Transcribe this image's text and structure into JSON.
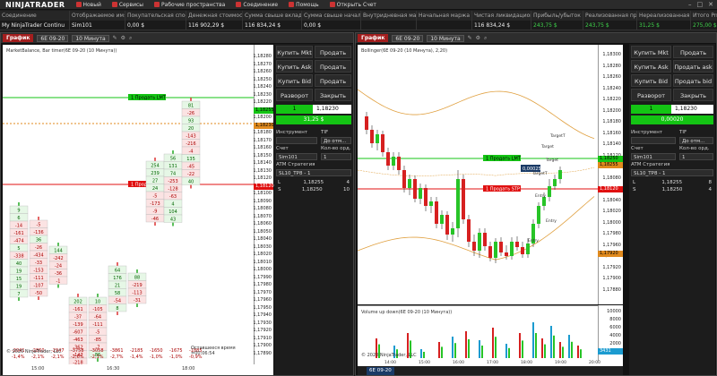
{
  "menu": {
    "logo": "NINJATRADER",
    "items": [
      "Новый",
      "Сервисы",
      "Рабочие пространства",
      "Соединение",
      "Помощь",
      "Открыть Счет"
    ]
  },
  "accounts": {
    "headers": [
      "Соединение",
      "Отображаемое имя",
      "Покупательская способ",
      "Денежная стоимость",
      "Сумма свыше вкладыв",
      "Сумма свыше начальн",
      "Внутридневная маржа",
      "Начальная маржа",
      "Чистая ликвидационна",
      "Прибыль/убыток до вы",
      "Реализованная прибы",
      "Нереализованная приб",
      "Итого PnL"
    ],
    "row": [
      "My NinjaTrader Continu",
      "Sim101",
      "0,00 $",
      "116 902,29 $",
      "116 834,24 $",
      "0,00 $",
      "",
      "",
      "116 834,24 $",
      "243,75 $",
      "243,75 $",
      "31,25 $",
      "275,00 $"
    ]
  },
  "left_chart": {
    "tab": "График",
    "instrument": "6E 09-20",
    "interval": "10 Минута",
    "title": "MarketBalance, Bar timer(6E 09-20 (10 Минута))",
    "prices": [
      "1,18280",
      "1,18270",
      "1,18260",
      "1,18250",
      "1,18240",
      "1,18230",
      "1,18220",
      "1,18210",
      "1,18200",
      "1,18190",
      "1,18180",
      "1,18170",
      "1,18160",
      "1,18150",
      "1,18140",
      "1,18130",
      "1,18120",
      "1,18110",
      "1,18100",
      "1,18090",
      "1,18080",
      "1,18070",
      "1,18060",
      "1,18050",
      "1,18040",
      "1,18030",
      "1,18020",
      "1,18010",
      "1,18000",
      "1,17990",
      "1,17980",
      "1,17970",
      "1,17960",
      "1,17950",
      "1,17940",
      "1,17930",
      "1,17920",
      "1,17910",
      "1,17900",
      "1,17890"
    ],
    "limit_tag": "1 Продать LMT",
    "stop_tag": "1 Продать STP",
    "limit_price": "1,18255",
    "stop_price": "1,18120",
    "last_price": "1,18230",
    "time_labels": [
      "15:00",
      "16:30",
      "18:00"
    ],
    "bottom_deltas": [
      "-2041",
      "-2860",
      "-2947",
      "-3758",
      "-3058",
      "-3861",
      "-2185",
      "-1650",
      "-1675",
      "-1885"
    ],
    "bottom_pcts": [
      "-1,4%",
      "-2,1%",
      "-2,1%",
      "-2,6%",
      "-2,1%",
      "-2,7%",
      "-1,4%",
      "-1,0%",
      "-1,0%",
      "-0,9%"
    ],
    "timer_text": "Оставшееся время =00:06:54",
    "copyright": "© 2020 NinjaTrader, LLC",
    "col1": [
      "9",
      "6",
      "-14",
      "-161",
      "-474",
      "5",
      "-338",
      "40",
      "19",
      "15",
      "19",
      "7"
    ],
    "col2": [
      "-5",
      "-136",
      "36",
      "-26",
      "-434",
      "-33",
      "-153",
      "-111",
      "-107",
      "-50"
    ],
    "col3": [
      "144",
      "-242",
      "-24",
      "-36",
      "-1"
    ],
    "col4": [
      "202",
      "-161",
      "-37",
      "-139",
      "-607",
      "-463",
      "-362",
      "-147",
      "-218",
      "-3",
      "-208",
      "232"
    ],
    "col5": [
      "10",
      "-105",
      "-64",
      "-111",
      "-5",
      "-85",
      "-7",
      "86"
    ],
    "col6": [
      "64",
      "176",
      "21",
      "58",
      "-54",
      "8"
    ],
    "col7": [
      "88",
      "-219",
      "-113",
      "-31"
    ],
    "col8": [
      "254",
      "239",
      "27",
      "24",
      "-5",
      "-173",
      "-9",
      "-46"
    ],
    "col9": [
      "56",
      "131",
      "74",
      "-253",
      "-128",
      "-63",
      "4",
      "104",
      "43"
    ],
    "col10": [
      "81",
      "-26",
      "93",
      "20",
      "-143",
      "-216",
      "-4",
      "135",
      "-45",
      "-22",
      "40"
    ]
  },
  "left_orders": {
    "buy_mkt": "Купить Mkt",
    "sell_mkt": "Продать Mkt",
    "buy_ask": "Купить Ask",
    "sell_ask": "Продать Ask",
    "buy_bid": "Купить Bid",
    "sell_bid": "Продать Bid",
    "reverse": "Разворот",
    "close": "Закрыть",
    "qty": "1",
    "price": "1,18230",
    "pnl": "31,25 $",
    "instrument_label": "Инструмент",
    "tif_label": "TIF",
    "tif_value": "До отм...",
    "account_label": "Счет",
    "account_value": "Sim101",
    "qtyord_label": "Кол-во орд.",
    "qtyord_value": "1",
    "atm_label": "ATM Стратегия",
    "atm_value": "SL10_TP8 - 1",
    "atm_rows": [
      [
        "L",
        "1,18255",
        "4"
      ],
      [
        "S",
        "1,18250",
        "10"
      ]
    ]
  },
  "right_chart": {
    "tab": "График",
    "instrument": "6E 09-20",
    "interval": "10 Минута",
    "title": "Bollinger(6E 09-20 (10 Минута), 2,20)",
    "prices": [
      "1,18300",
      "1,18280",
      "1,18260",
      "1,18240",
      "1,18220",
      "1,18200",
      "1,18180",
      "1,18160",
      "1,18140",
      "1,18120",
      "1,18100",
      "1,18080",
      "1,18060",
      "1,18040",
      "1,18020",
      "1,18000",
      "1,17980",
      "1,17960",
      "1,17940",
      "1,17920",
      "1,17900",
      "1,17880"
    ],
    "limit_tag": "1 Продать LMT",
    "stop_tag": "1 Продать STP",
    "limit_price": "1,18250",
    "stop_price": "1,18120",
    "last_price": "1,18255",
    "low_price": "1,17920",
    "entry_price": "0,00025",
    "volume_title": "Volume up down(6E 09-20 (10 Минута))",
    "volume_ticks": [
      "10000",
      "8000",
      "6000",
      "4000",
      "2000"
    ],
    "volume_last": "3431",
    "time_labels": [
      "14:00",
      "15:00",
      "16:00",
      "17:00",
      "18:00",
      "19:00",
      "20:00"
    ],
    "copyright": "© 2020 NinjaTrader, LLC",
    "annotations": [
      "TargetT",
      "Target",
      "Entry",
      "Entry",
      "Entry",
      "TargetT",
      "Target"
    ],
    "bottom_tab": "6E 09-20"
  },
  "right_orders": {
    "buy_mkt": "Купить Mkt",
    "sell_mkt": "Продать Mkt",
    "buy_ask": "Купить Ask",
    "sell_ask": "Продать ask",
    "buy_bid": "Купить Bid",
    "sell_bid": "Продать bid",
    "reverse": "Разворот",
    "close": "Закрыть",
    "qty": "1",
    "price": "1,18230",
    "pnl": "0,00020",
    "instrument_label": "Инструмент",
    "tif_label": "TIF",
    "tif_value": "До отм...",
    "account_label": "Счет",
    "account_value": "Sim101",
    "qtyord_label": "Кол-во орд.",
    "qtyord_value": "1",
    "atm_label": "ATM Стратегия",
    "atm_value": "SL10_TP8 - 1",
    "atm_rows": [
      [
        "L",
        "1,18255",
        "8"
      ],
      [
        "S",
        "1,18250",
        "4"
      ]
    ]
  },
  "colors": {
    "accent": "#a31e1e",
    "green": "#14c414",
    "red": "#e01010",
    "up": "#27c427",
    "down": "#d62020"
  }
}
